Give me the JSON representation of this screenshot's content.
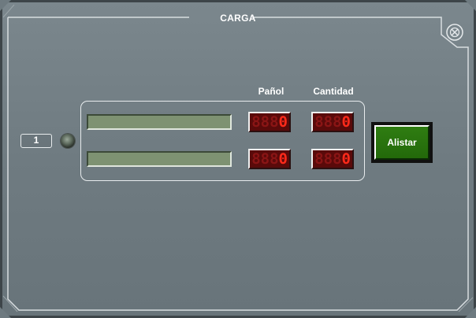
{
  "window": {
    "title": "CARGA"
  },
  "row_number": "1",
  "columns": {
    "panol": "Pañol",
    "cantidad": "Cantidad"
  },
  "rows": [
    {
      "field_value": "",
      "panol_ghost": "888",
      "panol_digit": "0",
      "cantidad_ghost": "888",
      "cantidad_digit": "0"
    },
    {
      "field_value": "",
      "panol_ghost": "888",
      "panol_digit": "0",
      "cantidad_ghost": "888",
      "cantidad_digit": "0"
    }
  ],
  "buttons": {
    "alistar": "Alistar"
  },
  "icons": {
    "close": "close-circle-x-icon",
    "status_led": "status-led-icon"
  },
  "colors": {
    "panel": "#6e7a80",
    "led_digit": "#ff2a1a",
    "button_green": "#2f7d12",
    "field_green": "#7e9272"
  }
}
